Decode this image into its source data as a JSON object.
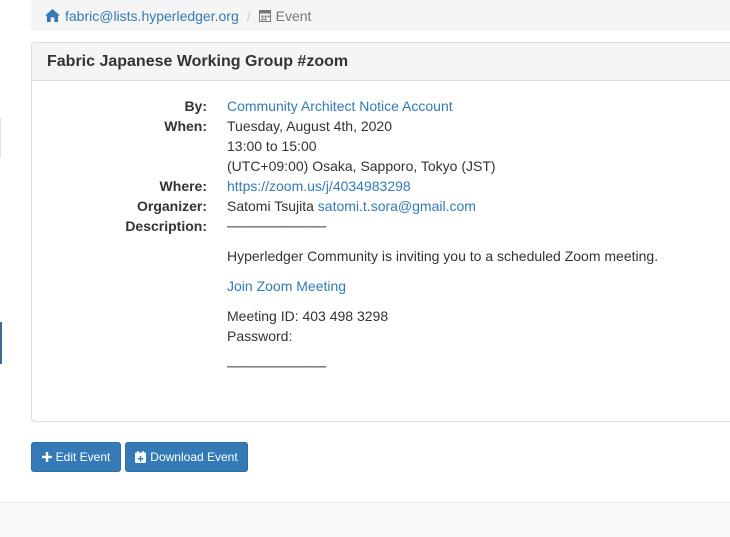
{
  "breadcrumb": {
    "group_link": "fabric@lists.hyperledger.org",
    "separator": "/",
    "current": "Event",
    "home_icon": "home-icon",
    "calendar_icon": "calendar-icon"
  },
  "event": {
    "title": "Fabric Japanese Working Group #zoom",
    "labels": {
      "by": "By:",
      "when": "When:",
      "where": "Where:",
      "organizer": "Organizer:",
      "description": "Description:"
    },
    "by": "Community Architect Notice Account",
    "when_date": "Tuesday, August 4th, 2020",
    "when_time": "13:00 to 15:00",
    "when_tz": "(UTC+09:00) Osaka, Sapporo, Tokyo (JST)",
    "where": "https://zoom.us/j/4034983298",
    "organizer_name": "Satomi Tsujita",
    "organizer_email": "satomi.t.sora@gmail.com",
    "description": {
      "rule_top": "──────────",
      "invite": "Hyperledger Community is inviting you to a scheduled Zoom meeting.",
      "join_link": "Join Zoom Meeting",
      "meeting_id": "Meeting ID: 403 498 3298",
      "password": "Password:",
      "rule_bottom": "──────────"
    }
  },
  "actions": {
    "edit": "Edit Event",
    "download": "Download Event",
    "edit_icon": "plus-icon",
    "download_icon": "calendar-plus-icon"
  },
  "colors": {
    "link": "#337ab7",
    "button": "#337ab7",
    "panel_heading": "#f5f5f5"
  }
}
